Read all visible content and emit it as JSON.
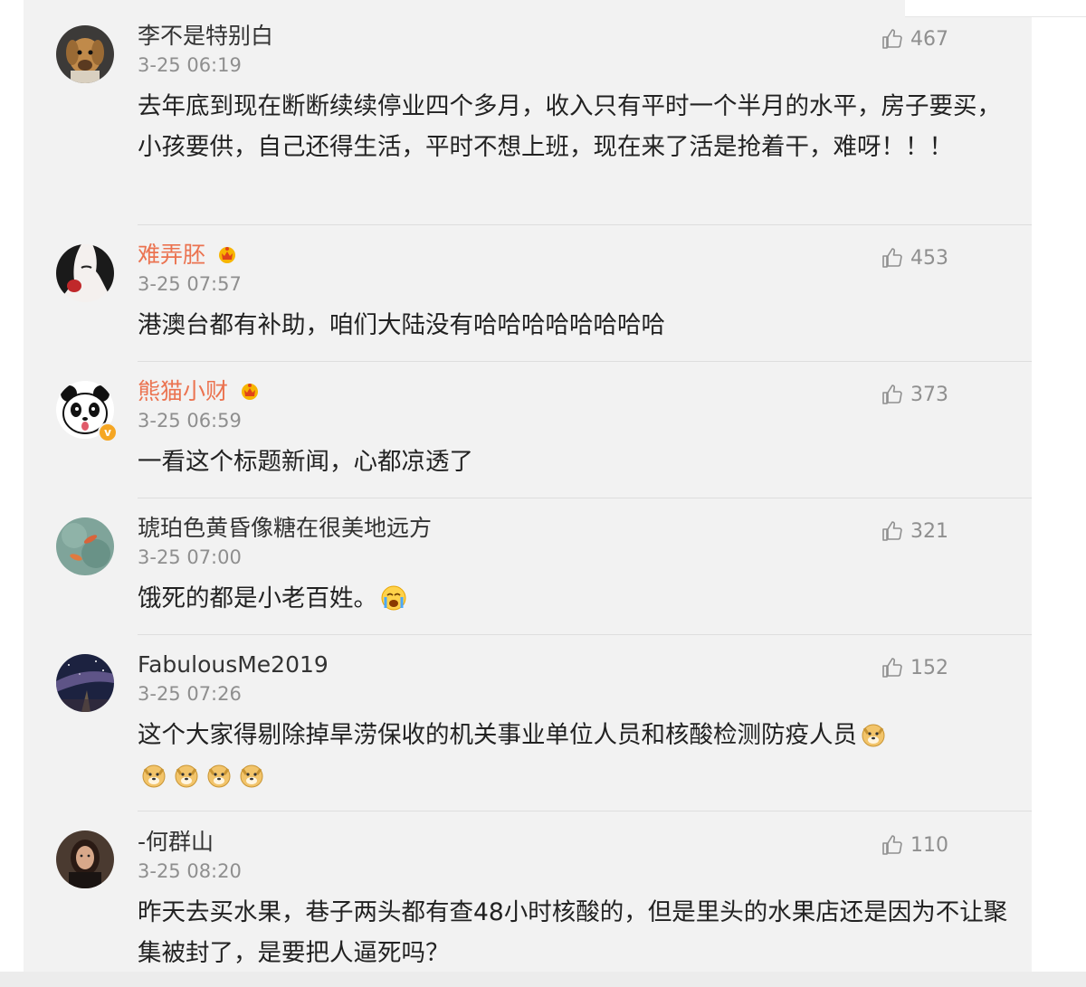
{
  "comments": [
    {
      "username": "李不是特别白",
      "vip": false,
      "verified": false,
      "timestamp": "3-25 06:19",
      "likes": "467",
      "text": "去年底到现在断断续续停业四个多月，收入只有平时一个半月的水平，房子要买，小孩要供，自己还得生活，平时不想上班，现在来了活是抢着干，难呀！！！",
      "avatar": "dog-avatar"
    },
    {
      "username": "难弄胚",
      "vip": true,
      "verified": false,
      "timestamp": "3-25 07:57",
      "likes": "453",
      "text": "港澳台都有补助，咱们大陆没有哈哈哈哈哈哈哈哈",
      "avatar": "face-avatar"
    },
    {
      "username": "熊猫小财",
      "vip": true,
      "verified": true,
      "timestamp": "3-25 06:59",
      "likes": "373",
      "text": "一看这个标题新闻，心都凉透了",
      "avatar": "panda-avatar"
    },
    {
      "username": "琥珀色黄昏像糖在很美地远方",
      "vip": false,
      "verified": false,
      "timestamp": "3-25 07:00",
      "likes": "321",
      "text": "饿死的都是小老百姓。",
      "trailing_emoji": [
        "crying-emoji"
      ],
      "avatar": "koi-avatar"
    },
    {
      "username": "FabulousMe2019",
      "vip": false,
      "verified": false,
      "timestamp": "3-25 07:26",
      "likes": "152",
      "text": "这个大家得剔除掉旱涝保收的机关事业单位人员和核酸检测防疫人员",
      "trailing_emoji": [
        "doge-emoji",
        "doge-emoji",
        "doge-emoji",
        "doge-emoji",
        "doge-emoji"
      ],
      "avatar": "galaxy-avatar"
    },
    {
      "username": "-何群山",
      "vip": false,
      "verified": false,
      "timestamp": "3-25 08:20",
      "likes": "110",
      "text": "昨天去买水果，巷子两头都有查48小时核酸的，但是里头的水果店还是因为不让聚集被封了，是要把人逼死吗？",
      "avatar": "woman-avatar"
    }
  ],
  "icons": {
    "like": "thumbs-up-icon",
    "vip": "vip-crown-icon",
    "verified": "verified-badge-icon"
  },
  "colors": {
    "vip_name": "#eb7350",
    "meta": "#8f8f8f",
    "verified": "#f5a623"
  }
}
